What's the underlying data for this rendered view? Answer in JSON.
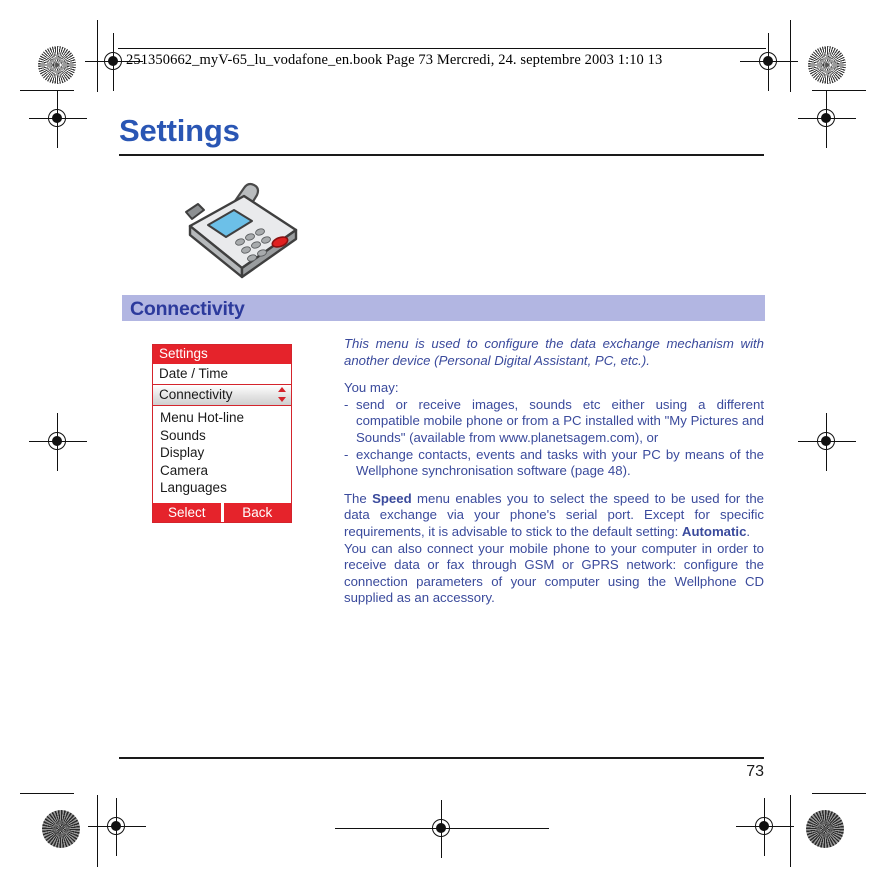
{
  "print_header": {
    "text": "251350662_myV-65_lu_vodafone_en.book  Page 73  Mercredi, 24. septembre 2003  1:10 13"
  },
  "page": {
    "title": "Settings",
    "number": "73"
  },
  "section": {
    "banner_label": "Connectivity",
    "banner_bg": "#b2b6e2",
    "banner_fg": "#2c3a9c"
  },
  "illustration": {
    "name": "mobile-phone-with-headset-illustration"
  },
  "phone_screen": {
    "title": "Settings",
    "rows": [
      {
        "label": "Date / Time",
        "selected": false
      },
      {
        "label": "Connectivity",
        "selected": true
      }
    ],
    "list_items": [
      "Menu Hot-line",
      "Sounds",
      "Display",
      "Camera",
      "Languages"
    ],
    "softkey_left": "Select",
    "softkey_right": "Back",
    "accent_color": "#e5232b"
  },
  "body": {
    "intro": "This menu is used to configure the data exchange mechanism with another device (Personal Digital Assistant, PC, etc.).",
    "you_may": "You may:",
    "bullets": [
      "send or receive images, sounds etc either using a different compatible mobile phone or from a PC installed with \"My Pictures and Sounds\" (available from www.planetsagem.com), or",
      "exchange contacts, events and tasks with your PC by means of the Wellphone synchronisation software (page 48)."
    ],
    "bullet_marker": "-",
    "speed_paragraph": {
      "before": "The ",
      "bold1": "Speed",
      "middle": " menu enables you to select the speed to be used for the data exchange via your phone's serial port. Except for specific requirements, it is advisable to stick to the default setting: ",
      "bold2": "Automatic",
      "after": "."
    },
    "closing": "You can also connect your mobile phone to your computer in order to receive data or fax through GSM or GPRS network: configure the connection parameters of your computer using the Wellphone CD supplied as an accessory."
  }
}
